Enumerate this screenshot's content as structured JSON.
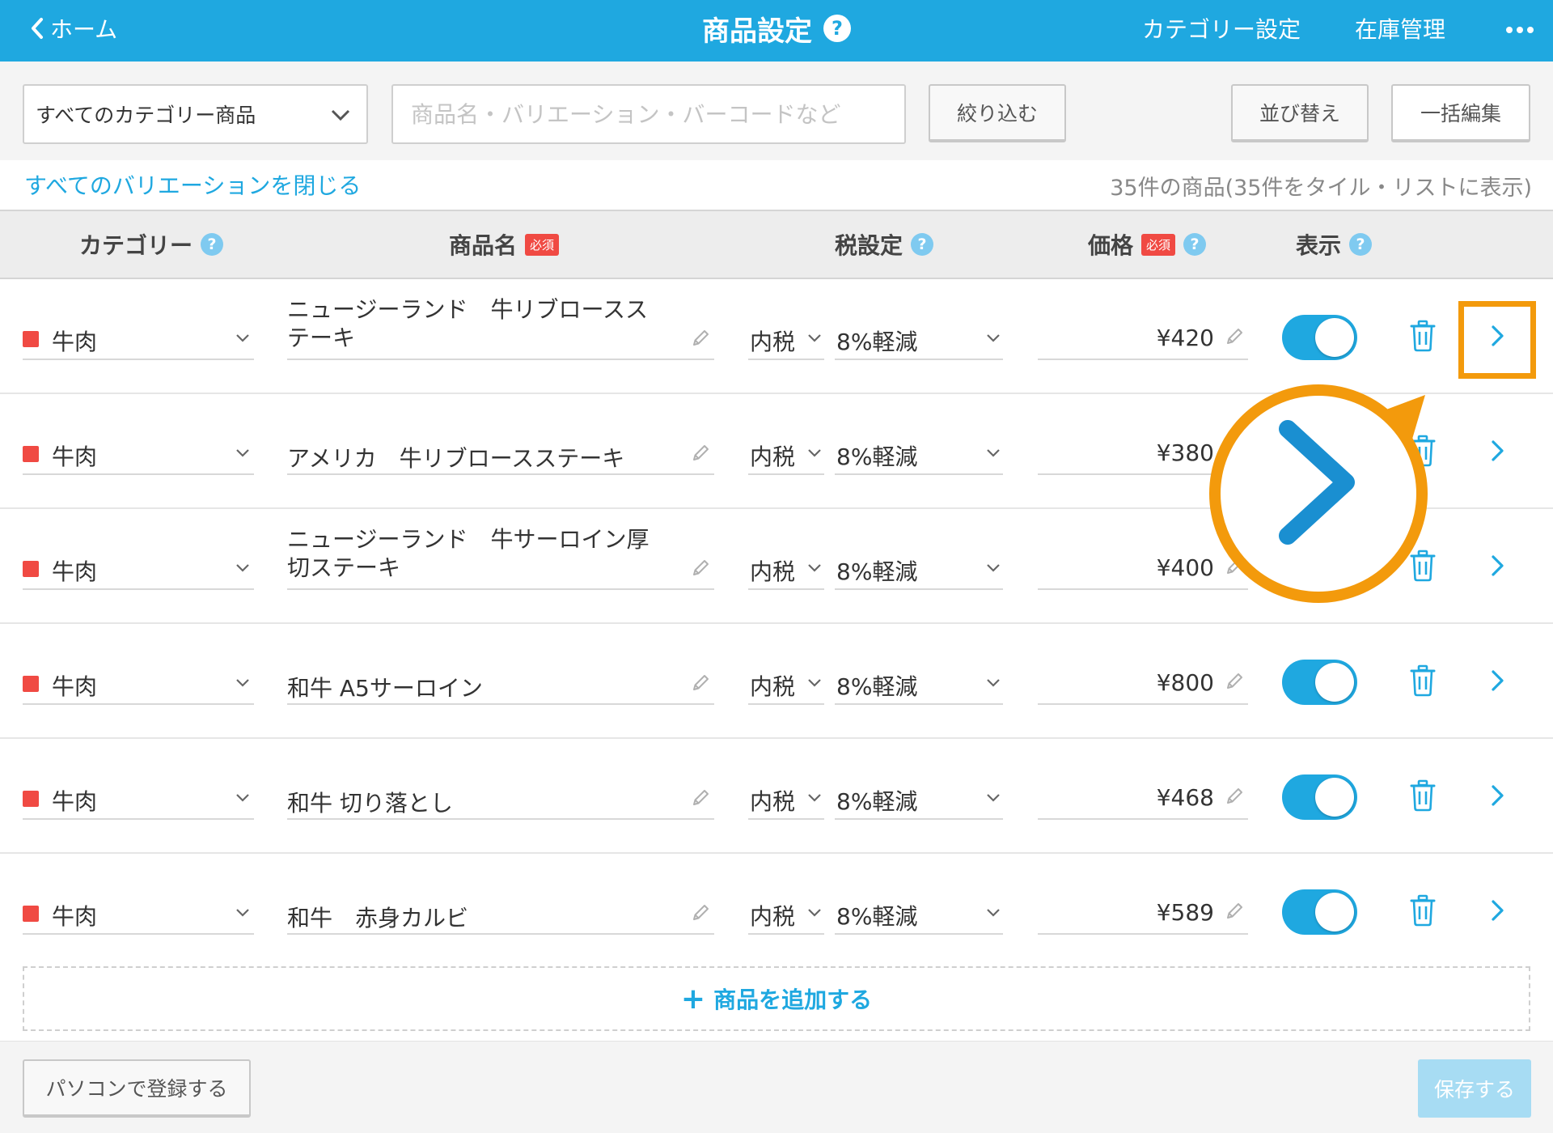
{
  "header": {
    "back_label": "ホーム",
    "title": "商品設定",
    "help_glyph": "?",
    "category_settings": "カテゴリー設定",
    "inventory": "在庫管理",
    "color": "#1fa8e0"
  },
  "toolbar": {
    "category_select_value": "すべてのカテゴリー商品",
    "search_placeholder": "商品名・バリエーション・バーコードなど",
    "filter_label": "絞り込む",
    "sort_label": "並び替え",
    "bulk_edit_label": "一括編集"
  },
  "info": {
    "collapse_link": "すべてのバリエーションを閉じる",
    "count_text": "35件の商品(35件をタイル・リストに表示)"
  },
  "table_headers": {
    "category": "カテゴリー",
    "name": "商品名",
    "required": "必須",
    "tax": "税設定",
    "price": "価格",
    "display": "表示",
    "help_glyph": "?"
  },
  "products": [
    {
      "category": "牛肉",
      "name": "ニュージーランド　牛リブロースステーキ",
      "tax_type": "内税",
      "tax_rate": "8%軽減",
      "price": "¥420",
      "visible": true
    },
    {
      "category": "牛肉",
      "name": "アメリカ　牛リブロースステーキ",
      "tax_type": "内税",
      "tax_rate": "8%軽減",
      "price": "¥380",
      "visible": true
    },
    {
      "category": "牛肉",
      "name": "ニュージーランド　牛サーロイン厚切ステーキ",
      "tax_type": "内税",
      "tax_rate": "8%軽減",
      "price": "¥400",
      "visible": true
    },
    {
      "category": "牛肉",
      "name": "和牛 A5サーロイン",
      "tax_type": "内税",
      "tax_rate": "8%軽減",
      "price": "¥800",
      "visible": true
    },
    {
      "category": "牛肉",
      "name": "和牛 切り落とし",
      "tax_type": "内税",
      "tax_rate": "8%軽減",
      "price": "¥468",
      "visible": true
    },
    {
      "category": "牛肉",
      "name": "和牛　赤身カルビ",
      "tax_type": "内税",
      "tax_rate": "8%軽減",
      "price": "¥589",
      "visible": true
    }
  ],
  "add_product_label": "商品を追加する",
  "footer": {
    "pc_register": "パソコンで登録する",
    "save": "保存する"
  },
  "colors": {
    "accent": "#1fa8e0",
    "highlight": "#f39a0c",
    "category_marker": "#f04a43"
  }
}
